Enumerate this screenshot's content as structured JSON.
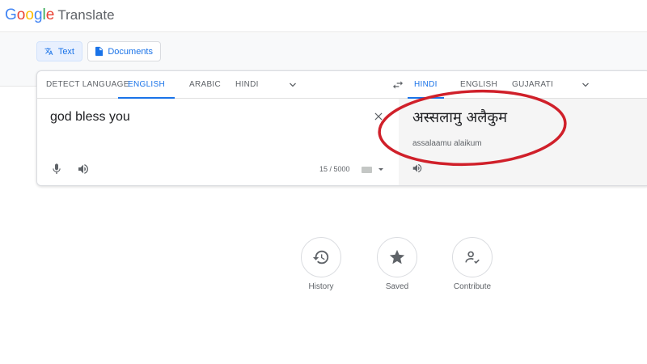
{
  "app": {
    "brand": "Google",
    "title": "Translate"
  },
  "modes": [
    {
      "label": "Text",
      "icon": "translate-icon",
      "active": true
    },
    {
      "label": "Documents",
      "icon": "document-icon",
      "active": false
    }
  ],
  "source_languages": [
    "DETECT LANGUAGE",
    "ENGLISH",
    "ARABIC",
    "HINDI"
  ],
  "source_selected": "ENGLISH",
  "target_languages": [
    "HINDI",
    "ENGLISH",
    "GUJARATI"
  ],
  "target_selected": "HINDI",
  "source": {
    "text": "god bless you",
    "char_count": "15 / 5000"
  },
  "target": {
    "text": "अस्सलामु अलैकुम",
    "transliteration": "assalaamu alaikum"
  },
  "quick_actions": [
    {
      "label": "History",
      "icon": "history-icon"
    },
    {
      "label": "Saved",
      "icon": "star-icon"
    },
    {
      "label": "Contribute",
      "icon": "contribute-icon"
    }
  ],
  "colors": {
    "accent": "#1a73e8",
    "annotation": "#d0202a"
  }
}
